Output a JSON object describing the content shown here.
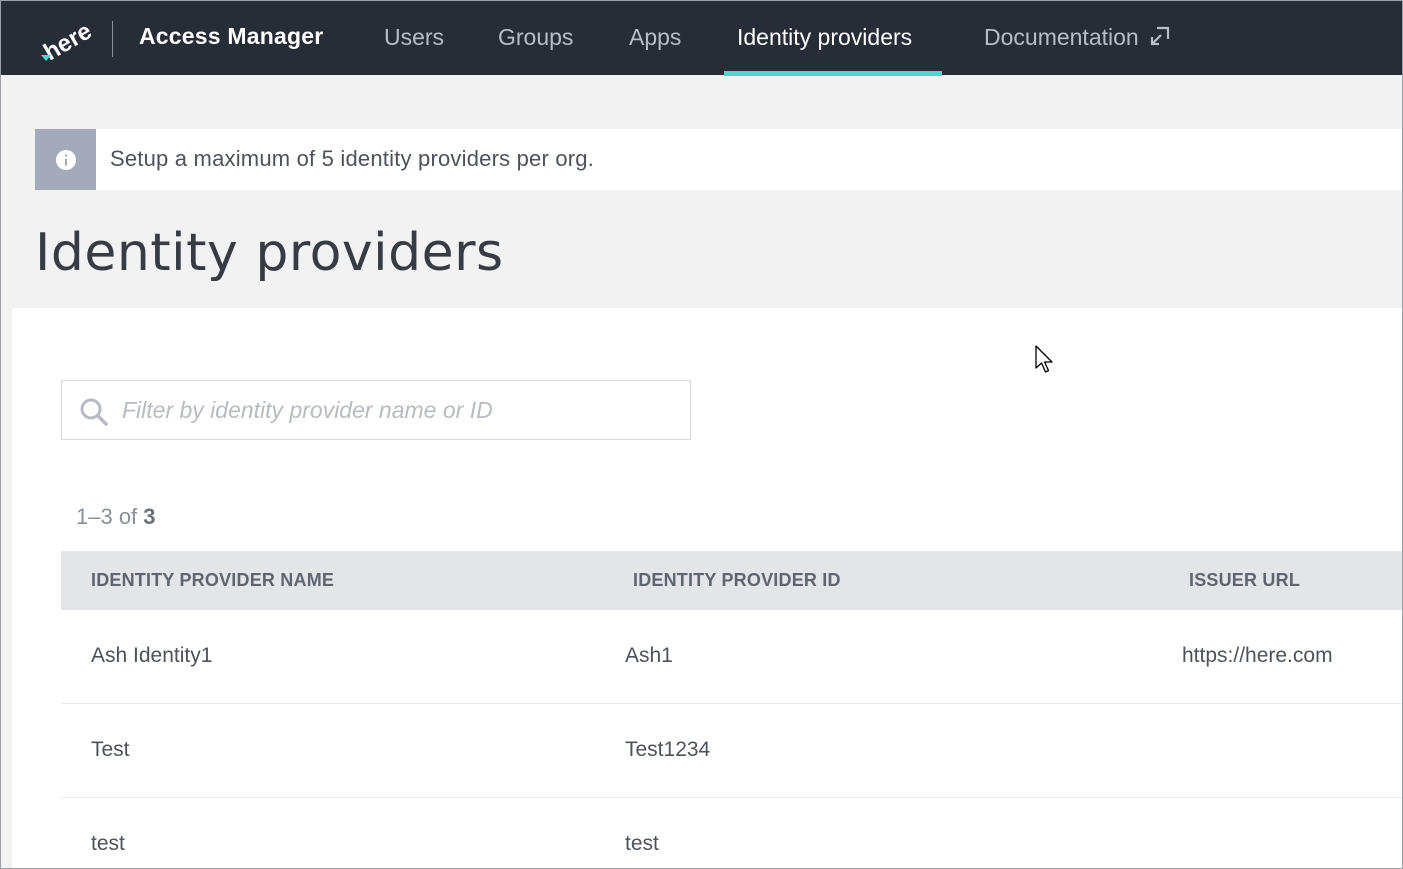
{
  "header": {
    "app_name": "Access Manager",
    "logo_text": "here",
    "nav": [
      {
        "label": "Users",
        "active": false
      },
      {
        "label": "Groups",
        "active": false
      },
      {
        "label": "Apps",
        "active": false
      },
      {
        "label": "Identity providers",
        "active": true
      },
      {
        "label": "Documentation",
        "active": false,
        "icon": "external-link-icon"
      }
    ],
    "accent_color": "#48dad0",
    "background_color": "#272d37"
  },
  "banner": {
    "icon": "info-icon",
    "text": "Setup a maximum of 5 identity providers per org."
  },
  "page": {
    "title": "Identity providers"
  },
  "search": {
    "placeholder": "Filter by identity provider name or ID",
    "value": ""
  },
  "results": {
    "range": "1–3 of ",
    "total": "3"
  },
  "table": {
    "columns": [
      "IDENTITY PROVIDER NAME",
      "IDENTITY PROVIDER ID",
      "ISSUER URL"
    ],
    "rows": [
      {
        "name": "Ash Identity1",
        "id": "Ash1",
        "issuer_url": "https://here.com"
      },
      {
        "name": "Test",
        "id": "Test1234",
        "issuer_url": ""
      },
      {
        "name": "test",
        "id": "test",
        "issuer_url": ""
      }
    ]
  }
}
